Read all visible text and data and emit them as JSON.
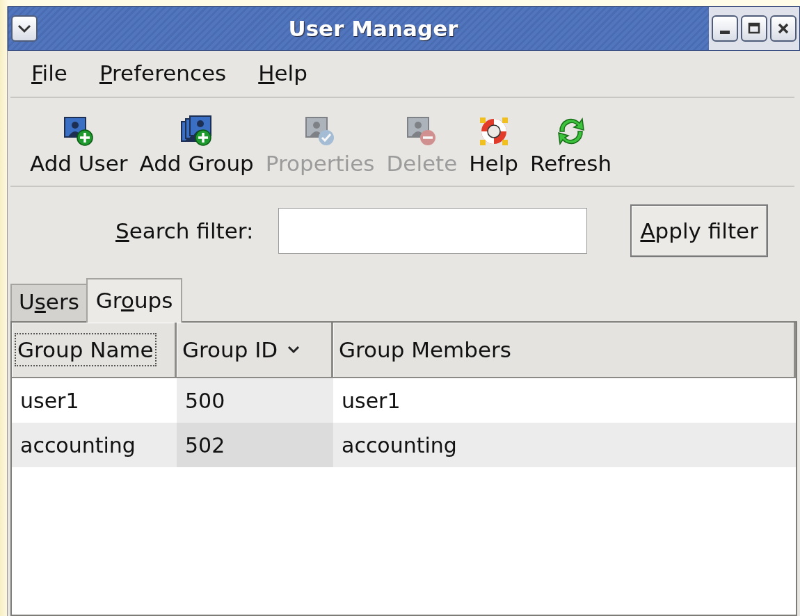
{
  "window": {
    "title": "User Manager"
  },
  "menu": [
    {
      "key": "F",
      "post": "ile"
    },
    {
      "key": "P",
      "post": "references"
    },
    {
      "key": "H",
      "post": "elp"
    }
  ],
  "toolbar": [
    {
      "label": "Add User",
      "kind": "add-user",
      "disabled": false
    },
    {
      "label": "Add Group",
      "kind": "add-group",
      "disabled": false
    },
    {
      "label": "Properties",
      "kind": "properties",
      "disabled": true
    },
    {
      "label": "Delete",
      "kind": "delete",
      "disabled": true
    },
    {
      "label": "Help",
      "kind": "help",
      "disabled": false
    },
    {
      "label": "Refresh",
      "kind": "refresh",
      "disabled": false
    }
  ],
  "search": {
    "label": {
      "key": "S",
      "post": "earch filter:"
    }
  },
  "apply_button": {
    "key": "A",
    "post": "pply filter"
  },
  "tabs": [
    {
      "label": {
        "pre": "U",
        "key": "s",
        "post": "ers"
      },
      "selected": false
    },
    {
      "label": {
        "pre": "Gr",
        "key": "o",
        "post": "ups"
      },
      "selected": true
    }
  ],
  "table": {
    "columns": [
      {
        "label": "Group Name",
        "focused": true,
        "sorted": false
      },
      {
        "label": "Group ID",
        "focused": false,
        "sorted": true
      },
      {
        "label": "Group Members",
        "focused": false,
        "sorted": false
      }
    ],
    "rows": [
      {
        "cells": [
          "user1",
          "500",
          "user1"
        ],
        "shaded": false
      },
      {
        "cells": [
          "accounting",
          "502",
          "accounting"
        ],
        "shaded": true
      }
    ]
  }
}
